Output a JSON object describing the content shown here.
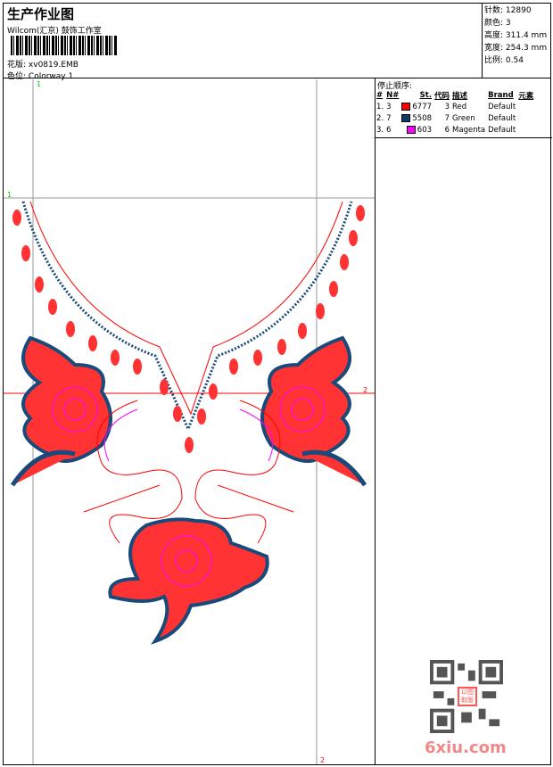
{
  "header": {
    "title": "生产作业图",
    "company": "Wilcom(汇京) 鼓饰工作室",
    "design_file_label": "花版:",
    "design_file": "xv0819.EMB",
    "colorway_label": "色位:",
    "colorway": "Colorway 1"
  },
  "stats": [
    {
      "label": "针数:",
      "value": "12890"
    },
    {
      "label": "颜色:",
      "value": "3"
    },
    {
      "label": "高度:",
      "value": "311.4 mm"
    },
    {
      "label": "宽度:",
      "value": "254.3 mm"
    },
    {
      "label": "比例:",
      "value": "0.54"
    }
  ],
  "stop_sequence": {
    "title": "停止顺序:",
    "headers": [
      "#",
      "N#",
      "St.",
      "代码",
      "描述",
      "Brand",
      "元素"
    ],
    "rows": [
      {
        "idx": "1.",
        "n": "3",
        "color": "#ff0000",
        "st": "6777",
        "code": "3",
        "desc": "Red",
        "brand": "Default"
      },
      {
        "idx": "2.",
        "n": "7",
        "color": "#123a6a",
        "st": "5508",
        "code": "7",
        "desc": "Green",
        "brand": "Default"
      },
      {
        "idx": "3.",
        "n": "6",
        "color": "#ff00ff",
        "st": "603",
        "code": "6",
        "desc": "Magenta",
        "brand": "Default"
      }
    ]
  },
  "guides": {
    "v1": "1",
    "h1": "1",
    "h2": "2",
    "v2": "2"
  },
  "watermark": {
    "site": "6xiu.com",
    "stamp": "以图取版"
  }
}
